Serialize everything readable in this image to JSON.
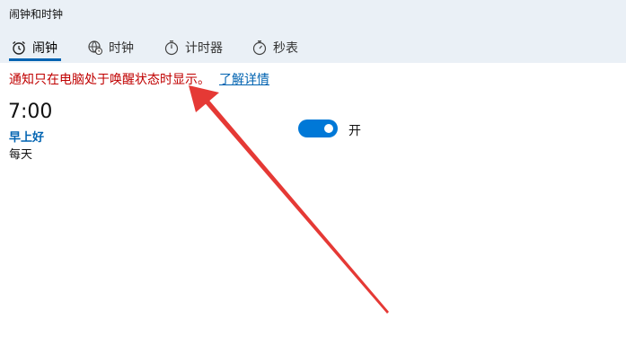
{
  "window": {
    "title": "闹钟和时钟"
  },
  "tabs": [
    {
      "label": "闹钟",
      "icon": "alarm-clock-icon",
      "active": true
    },
    {
      "label": "时钟",
      "icon": "world-clock-icon",
      "active": false
    },
    {
      "label": "计时器",
      "icon": "timer-icon",
      "active": false
    },
    {
      "label": "秒表",
      "icon": "stopwatch-icon",
      "active": false
    }
  ],
  "notice": {
    "text": "通知只在电脑处于唤醒状态时显示。",
    "link": "了解详情"
  },
  "alarm": {
    "time": "7:00",
    "name": "早上好",
    "repeat": "每天",
    "toggle_state": "开",
    "toggle_on": true
  },
  "annotation": {
    "type": "red-arrow",
    "color": "#e53935"
  },
  "colors": {
    "accent": "#0078d7",
    "link": "#0063b1",
    "warning": "#c00000",
    "header_bg": "#eaf0f6"
  }
}
